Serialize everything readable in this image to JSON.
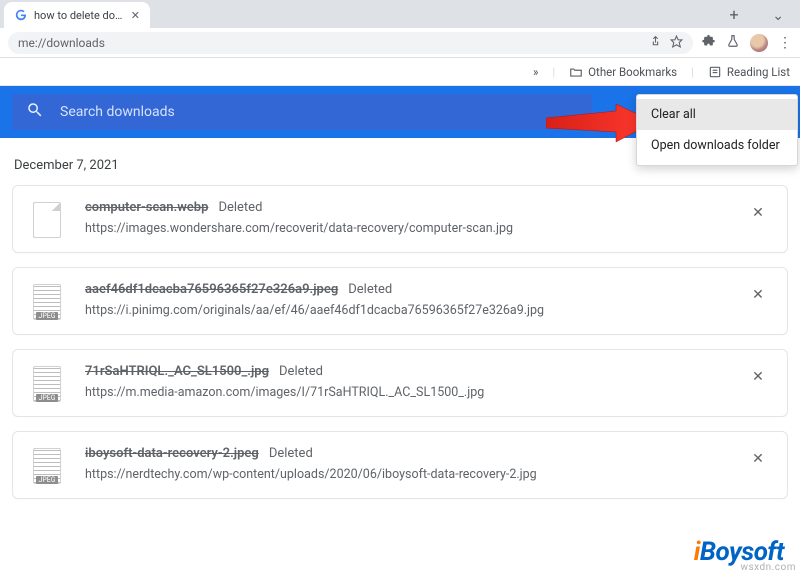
{
  "browser": {
    "tab_title": "how to delete do…",
    "url": "me://downloads",
    "bookmarks": {
      "other": "Other Bookmarks",
      "reading": "Reading List"
    }
  },
  "search": {
    "placeholder": "Search downloads"
  },
  "menu": {
    "clear_all": "Clear all",
    "open_folder": "Open downloads folder"
  },
  "date_header": "December 7, 2021",
  "status_deleted": "Deleted",
  "jpeg_tag": "JPEG",
  "downloads": [
    {
      "name": "computer-scan.webp",
      "url": "https://images.wondershare.com/recoverit/data-recovery/computer-scan.jpg",
      "thumb": "generic"
    },
    {
      "name": "aaef46df1dcacba76596365f27e326a9.jpeg",
      "url": "https://i.pinimg.com/originals/aa/ef/46/aaef46df1dcacba76596365f27e326a9.jpg",
      "thumb": "jpeg"
    },
    {
      "name": "71rSaHTRIQL._AC_SL1500_.jpg",
      "url": "https://m.media-amazon.com/images/I/71rSaHTRIQL._AC_SL1500_.jpg",
      "thumb": "jpeg"
    },
    {
      "name": "iboysoft-data-recovery-2.jpeg",
      "url": "https://nerdtechy.com/wp-content/uploads/2020/06/iboysoft-data-recovery-2.jpg",
      "thumb": "jpeg"
    }
  ],
  "watermark": {
    "logo_i": "i",
    "logo_rest": "Boysoft",
    "site": "wsxdn.com"
  }
}
